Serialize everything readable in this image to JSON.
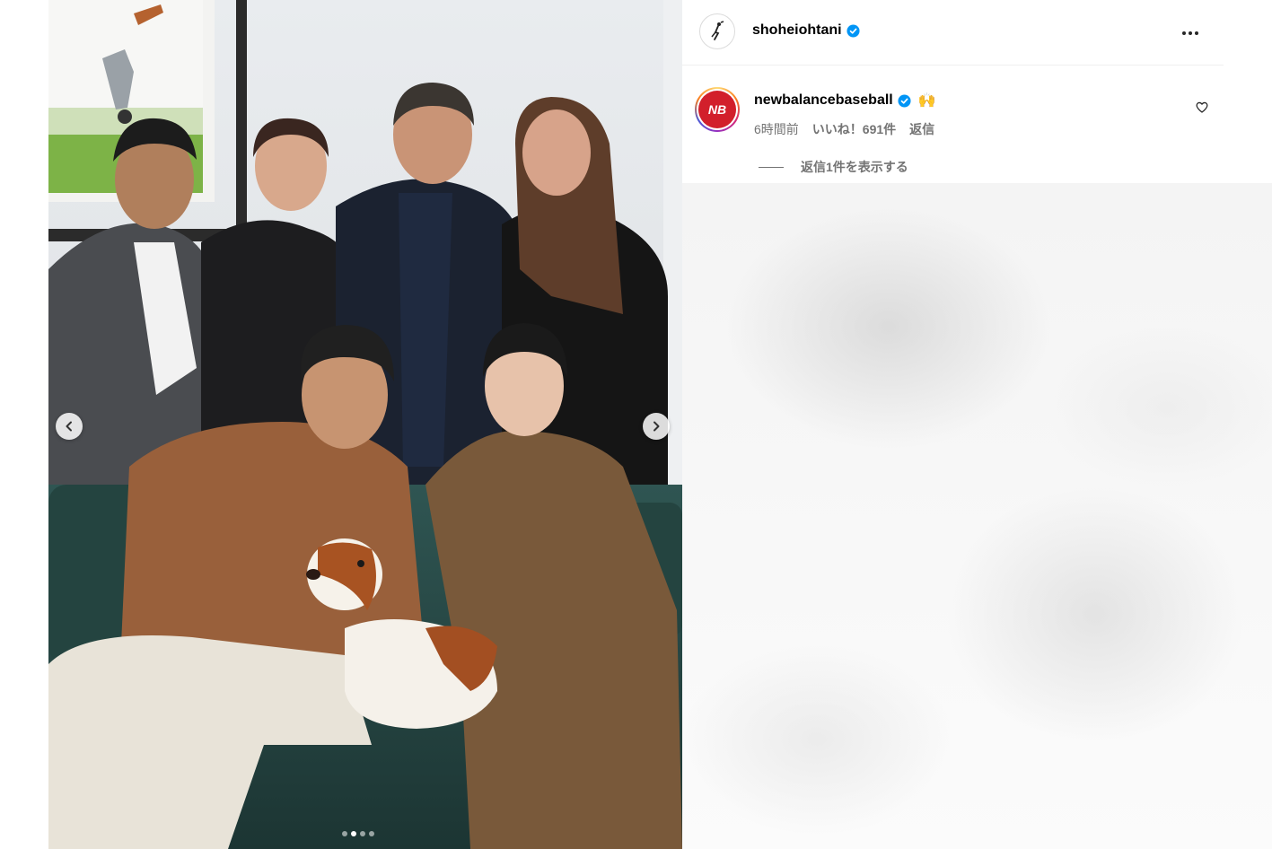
{
  "post": {
    "username": "shoheiohtani",
    "verified": true,
    "more_icon": "more-horizontal-icon",
    "carousel": {
      "slide_count": 4,
      "active_index": 1
    }
  },
  "comment": {
    "username": "newbalancebaseball",
    "verified": true,
    "emoji": "🙌",
    "time_ago": "6時間前",
    "likes_label": "いいね！691件",
    "reply_label": "返信",
    "view_replies_label": "返信1件を表示する",
    "like_icon": "heart-outline-icon"
  },
  "colors": {
    "verified_blue": "#0095f6",
    "meta_gray": "#737373",
    "nb_red": "#d21f2b"
  }
}
